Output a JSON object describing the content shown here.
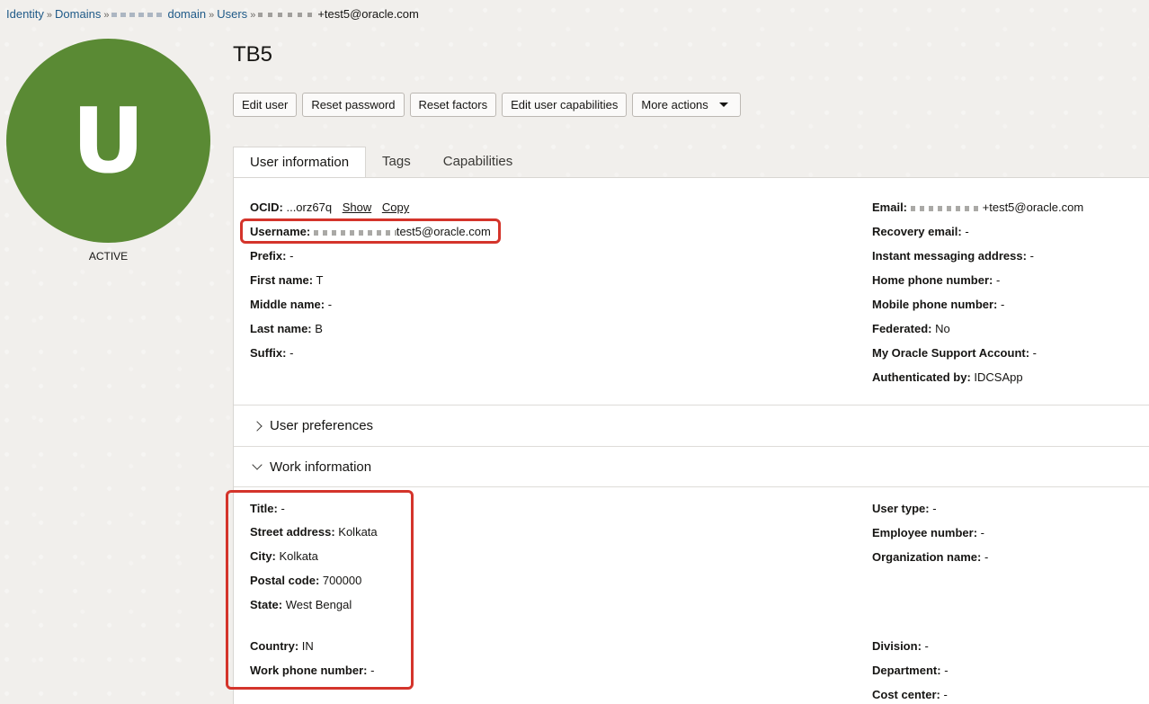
{
  "breadcrumb": {
    "identity": "Identity",
    "domains": "Domains",
    "domain": "domain",
    "users": "Users",
    "current": "+test5@oracle.com"
  },
  "avatar": {
    "initial": "U",
    "color": "#5a8a34"
  },
  "status": "ACTIVE",
  "title": "TB5",
  "actions": {
    "edit_user": "Edit user",
    "reset_password": "Reset password",
    "reset_factors": "Reset factors",
    "edit_capabilities": "Edit user capabilities",
    "more_actions": "More actions"
  },
  "tabs": [
    "User information",
    "Tags",
    "Capabilities"
  ],
  "user_info": {
    "ocid_label": "OCID:",
    "ocid_value": "...orz67q",
    "show": "Show",
    "copy": "Copy",
    "username_label": "Username:",
    "username_value": "test5@oracle.com",
    "prefix_label": "Prefix:",
    "prefix_value": "-",
    "first_label": "First name:",
    "first_value": "T",
    "middle_label": "Middle name:",
    "middle_value": "-",
    "last_label": "Last name:",
    "last_value": "B",
    "suffix_label": "Suffix:",
    "suffix_value": "-",
    "email_label": "Email:",
    "email_value": "+test5@oracle.com",
    "recovery_label": "Recovery email:",
    "recovery_value": "-",
    "im_label": "Instant messaging address:",
    "im_value": "-",
    "home_label": "Home phone number:",
    "home_value": "-",
    "mobile_label": "Mobile phone number:",
    "mobile_value": "-",
    "federated_label": "Federated:",
    "federated_value": "No",
    "mos_label": "My Oracle Support Account:",
    "mos_value": "-",
    "auth_label": "Authenticated by:",
    "auth_value": "IDCSApp"
  },
  "sections": {
    "user_preferences": "User preferences",
    "work_information": "Work information"
  },
  "work_info": {
    "title_label": "Title:",
    "title_value": "-",
    "street_label": "Street address:",
    "street_value": "Kolkata",
    "city_label": "City:",
    "city_value": "Kolkata",
    "postal_label": "Postal code:",
    "postal_value": "700000",
    "state_label": "State:",
    "state_value": "West Bengal",
    "country_label": "Country:",
    "country_value": "IN",
    "work_phone_label": "Work phone number:",
    "work_phone_value": "-",
    "user_type_label": "User type:",
    "user_type_value": "-",
    "emp_num_label": "Employee number:",
    "emp_num_value": "-",
    "org_label": "Organization name:",
    "org_value": "-",
    "division_label": "Division:",
    "division_value": "-",
    "department_label": "Department:",
    "department_value": "-",
    "cost_label": "Cost center:",
    "cost_value": "-"
  },
  "colors": {
    "highlight": "#d4342b",
    "link": "#1f5a88"
  }
}
